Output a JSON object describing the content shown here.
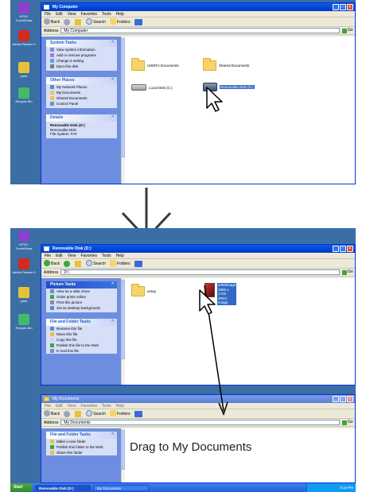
{
  "desktop_icons": [
    {
      "label": "UPDC TouchlDraw",
      "color": "#8c3fd1",
      "icon": "touchdraw-icon"
    },
    {
      "label": "Adobe Reader 9",
      "color": "#d42b1e",
      "icon": "adobe-reader-icon"
    },
    {
      "label": "paint",
      "color": "#e8c13c",
      "icon": "paint-icon"
    },
    {
      "label": "Recycle Bin",
      "color": "#44b96a",
      "icon": "recycle-bin-icon"
    }
  ],
  "menu": [
    "File",
    "Edit",
    "View",
    "Favorites",
    "Tools",
    "Help"
  ],
  "toolbar": {
    "back": "Back",
    "search": "Search",
    "folders": "Folders"
  },
  "address_label": "Address",
  "go_label": "Go",
  "window1": {
    "title": "My Computer",
    "address": "My Computer",
    "tasks": {
      "header": "System Tasks",
      "items": [
        "View system information",
        "Add or remove programs",
        "Change a setting",
        "Eject this disk"
      ]
    },
    "other": {
      "header": "Other Places",
      "items": [
        "My Network Places",
        "My Documents",
        "Shared Documents",
        "Control Panel"
      ]
    },
    "details": {
      "header": "Details",
      "name": "Removable Disk (D:)",
      "type": "Removable Disk",
      "fs": "File System: FAT"
    },
    "items": [
      {
        "label": "USER's Documents",
        "kind": "folder"
      },
      {
        "label": "Shared Documents",
        "kind": "folder"
      },
      {
        "label": "Local Disk (C:)",
        "kind": "drive"
      },
      {
        "label": "Removable Disk (D:)",
        "kind": "removable"
      }
    ]
  },
  "window2": {
    "title": "Removable Disk (D:)",
    "address": "D:\\",
    "picture_tasks": {
      "header": "Picture Tasks",
      "items": [
        "View as a slide show",
        "Order prints online",
        "Print this picture",
        "Set as desktop background"
      ]
    },
    "file_tasks": {
      "header": "File and Folder Tasks",
      "items": [
        "Rename this file",
        "Move this file",
        "Copy this file",
        "Publish this file to the Web",
        "E-mail this file"
      ]
    },
    "items": [
      {
        "label": "setup",
        "kind": "folder"
      },
      {
        "label": "2050image 2896 x 1728 JPEG Image",
        "kind": "image"
      }
    ]
  },
  "window3": {
    "title": "My Documents",
    "address": "My Documents",
    "file_tasks": {
      "header": "File and Folder Tasks",
      "items": [
        "Make a new folder",
        "Publish this folder to the Web",
        "Share this folder"
      ]
    }
  },
  "annotation": "Drag to My Documents",
  "taskbar": {
    "start": "Start",
    "buttons": [
      "Removable Disk (D:)",
      "My Documents"
    ],
    "clock": "5:15 PM"
  }
}
